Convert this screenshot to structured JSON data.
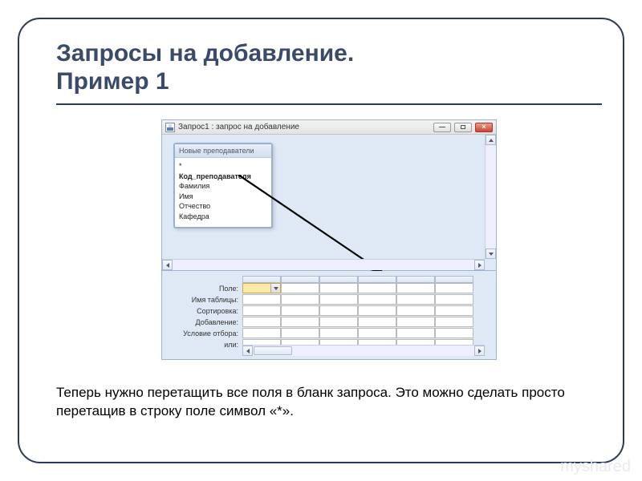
{
  "slide": {
    "title_line1": "Запросы на добавление.",
    "title_line2": "Пример 1"
  },
  "window": {
    "title": "Запрос1 : запрос на добавление"
  },
  "table_box": {
    "header": "Новые преподаватели",
    "fields": {
      "star": "*",
      "key": "Код_преподавателя",
      "f1": "Фамилия",
      "f2": "Имя",
      "f3": "Отчество",
      "f4": "Кафедра"
    }
  },
  "grid_labels": {
    "r1": "Поле:",
    "r2": "Имя таблицы:",
    "r3": "Сортировка:",
    "r4": "Добавление:",
    "r5": "Условие отбора:",
    "r6": "или:"
  },
  "body_text": "Теперь нужно перетащить все поля в бланк запроса. Это можно сделать просто перетащив в строку поле символ «*».",
  "watermark": "myshared"
}
